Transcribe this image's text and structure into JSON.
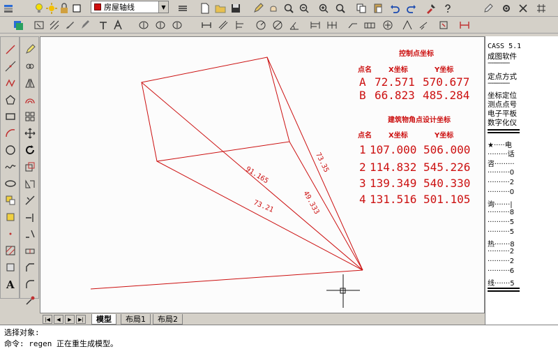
{
  "toolbar": {
    "layer_name": "房屋轴线"
  },
  "canvas": {
    "annotations": {
      "diag1": "91.165",
      "diag2": "73.21",
      "diag3": "73.35",
      "diag4": "49.333"
    },
    "control_table": {
      "title": "控制点坐标",
      "headers": [
        "点名",
        "X坐标",
        "Y坐标"
      ],
      "rows": [
        {
          "name": "A",
          "x": "72.571",
          "y": "570.677"
        },
        {
          "name": "B",
          "x": "66.823",
          "y": "485.284"
        }
      ]
    },
    "design_table": {
      "title": "建筑物角点设计坐标",
      "headers": [
        "点名",
        "X坐标",
        "Y坐标"
      ],
      "rows": [
        {
          "name": "1",
          "x": "107.000",
          "y": "506.000"
        },
        {
          "name": "2",
          "x": "114.832",
          "y": "545.226"
        },
        {
          "name": "3",
          "x": "139.349",
          "y": "540.330"
        },
        {
          "name": "4",
          "x": "131.516",
          "y": "501.105"
        }
      ]
    }
  },
  "tabs": {
    "model": "模型",
    "layout1": "布局1",
    "layout2": "布局2"
  },
  "right_panel": {
    "title": "CASS 5.1",
    "subtitle": "成图软件",
    "section1": "定点方式",
    "items": [
      "坐标定位",
      "测点点号",
      "电子平板",
      "数字化仪"
    ],
    "lines": [
      "★·····电",
      "·········话",
      "咨·········",
      "··········0",
      "··········2",
      "··········0",
      "询·······|",
      "··········8",
      "··········5",
      "··········5",
      "热·······8",
      "··········2",
      "··········2",
      "··········6",
      "线·······5"
    ]
  },
  "command": {
    "line1": "选择对象:",
    "line2": "命令:  regen 正在重生成模型。"
  },
  "colors": {
    "drawing": "#cc1010",
    "canvas_bg": "#fcfcfc",
    "chrome": "#d4d0c8"
  }
}
